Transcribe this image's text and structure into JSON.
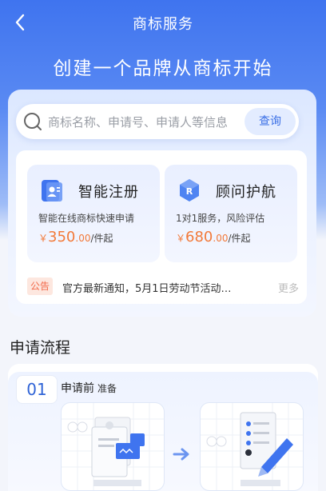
{
  "header": {
    "title": "商标服务",
    "slogan": "创建一个品牌从商标开始"
  },
  "search": {
    "placeholder": "商标名称、申请号、申请人等信息",
    "button_label": "查询"
  },
  "services": [
    {
      "title": "智能注册",
      "desc": "智能在线商标快速申请",
      "currency": "￥",
      "price_int": "350",
      "price_dec": ".00",
      "unit": "/件起",
      "icon": "id-card-icon"
    },
    {
      "title": "顾问护航",
      "desc": "1对1服务，风险评估",
      "currency": "￥",
      "price_int": "680",
      "price_dec": ".00",
      "unit": "/件起",
      "icon": "r-hexagon-icon"
    }
  ],
  "notice": {
    "tag": "公告",
    "text": "官方最新通知，5月1日劳动节活动…",
    "more": "更多"
  },
  "process": {
    "section_title": "申请流程",
    "step": {
      "number": "01",
      "label": "申请前",
      "sublabel": "准备"
    }
  },
  "colors": {
    "brand_blue": "#3f74ef",
    "price_orange": "#f27a3a",
    "notice_red": "#f26a4a"
  }
}
